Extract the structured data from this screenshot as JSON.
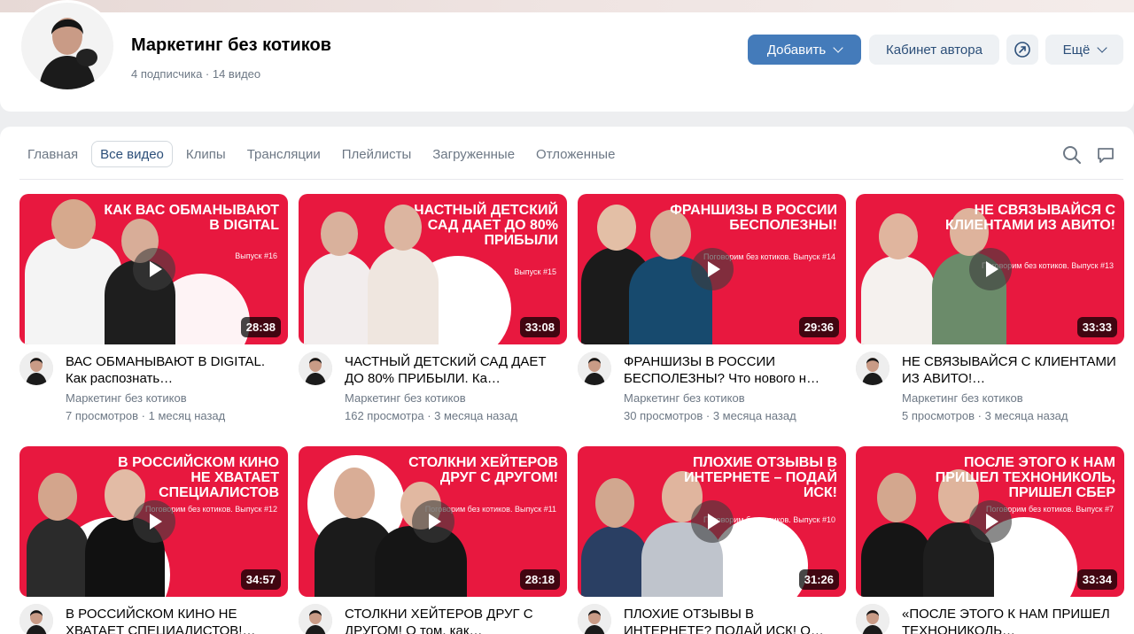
{
  "channel": {
    "title": "Маркетинг без котиков",
    "meta": "4 подписчика · 14 видео"
  },
  "buttons": {
    "add": "Добавить",
    "cabinet": "Кабинет автора",
    "more": "Ещё"
  },
  "tabs": [
    "Главная",
    "Все видео",
    "Клипы",
    "Трансляции",
    "Плейлисты",
    "Загруженные",
    "Отложенные"
  ],
  "active_tab": "Все видео",
  "colors": {
    "accent": "#447bba",
    "thumb_red": "#e8183f",
    "muted": "#6d7885"
  },
  "icons": {
    "search": "search-icon",
    "chat": "chat-icon",
    "share": "share-arrow-icon"
  },
  "videos": [
    {
      "thumb_title": "КАК ВАС ОБМАНЫВАЮТ В DIGITAL",
      "thumb_sub": "Выпуск #16",
      "duration": "28:38",
      "title": "ВАС ОБМАНЫВАЮТ В DIGITAL. Как распознать…",
      "channel": "Маркетинг без котиков",
      "meta": "7 просмотров · 1 месяц назад"
    },
    {
      "thumb_title": "ЧАСТНЫЙ ДЕТСКИЙ САД ДАЕТ ДО 80% ПРИБЫЛИ",
      "thumb_sub": "Выпуск #15",
      "duration": "33:08",
      "title": "ЧАСТНЫЙ ДЕТСКИЙ САД ДАЕТ ДО 80% ПРИБЫЛИ. Ка…",
      "channel": "Маркетинг без котиков",
      "meta": "162 просмотра · 3 месяца назад"
    },
    {
      "thumb_title": "ФРАНШИЗЫ В РОССИИ БЕСПОЛЕЗНЫ!",
      "thumb_sub": "Поговорим без котиков. Выпуск #14",
      "duration": "29:36",
      "title": "ФРАНШИЗЫ В РОССИИ БЕСПОЛЕЗНЫ? Что нового н…",
      "channel": "Маркетинг без котиков",
      "meta": "30 просмотров · 3 месяца назад"
    },
    {
      "thumb_title": "НЕ СВЯЗЫВАЙСЯ С КЛИЕНТАМИ ИЗ АВИТО!",
      "thumb_sub": "Поговорим без котиков. Выпуск #13",
      "duration": "33:33",
      "title": "НЕ СВЯЗЫВАЙСЯ С КЛИЕНТАМИ ИЗ АВИТО!…",
      "channel": "Маркетинг без котиков",
      "meta": "5 просмотров · 3 месяца назад"
    },
    {
      "thumb_title": "В РОССИЙСКОМ КИНО НЕ ХВАТАЕТ СПЕЦИАЛИСТОВ",
      "thumb_sub": "Поговорим без котиков. Выпуск #12",
      "duration": "34:57",
      "title": "В РОССИЙСКОМ КИНО НЕ ХВАТАЕТ СПЕЦИАЛИСТОВ!…",
      "channel": "",
      "meta": ""
    },
    {
      "thumb_title": "СТОЛКНИ ХЕЙТЕРОВ ДРУГ С ДРУГОМ!",
      "thumb_sub": "Поговорим без котиков. Выпуск #11",
      "duration": "28:18",
      "title": "СТОЛКНИ ХЕЙТЕРОВ ДРУГ С ДРУГОМ! О том, как…",
      "channel": "",
      "meta": ""
    },
    {
      "thumb_title": "ПЛОХИЕ ОТЗЫВЫ В ИНТЕРНЕТЕ – ПОДАЙ ИСК!",
      "thumb_sub": "Поговорим без котиков. Выпуск #10",
      "duration": "31:26",
      "title": "ПЛОХИЕ ОТЗЫВЫ В ИНТЕРНЕТЕ? ПОДАЙ ИСК! О…",
      "channel": "",
      "meta": ""
    },
    {
      "thumb_title": "ПОСЛЕ ЭТОГО К НАМ ПРИШЕЛ ТЕХНОНИКОЛЬ, ПРИШЕЛ СБЕР",
      "thumb_sub": "Поговорим без котиков. Выпуск #7",
      "duration": "33:34",
      "title": "«ПОСЛЕ ЭТОГО К НАМ ПРИШЕЛ ТЕХНОНИКОЛЬ…",
      "channel": "",
      "meta": ""
    }
  ]
}
